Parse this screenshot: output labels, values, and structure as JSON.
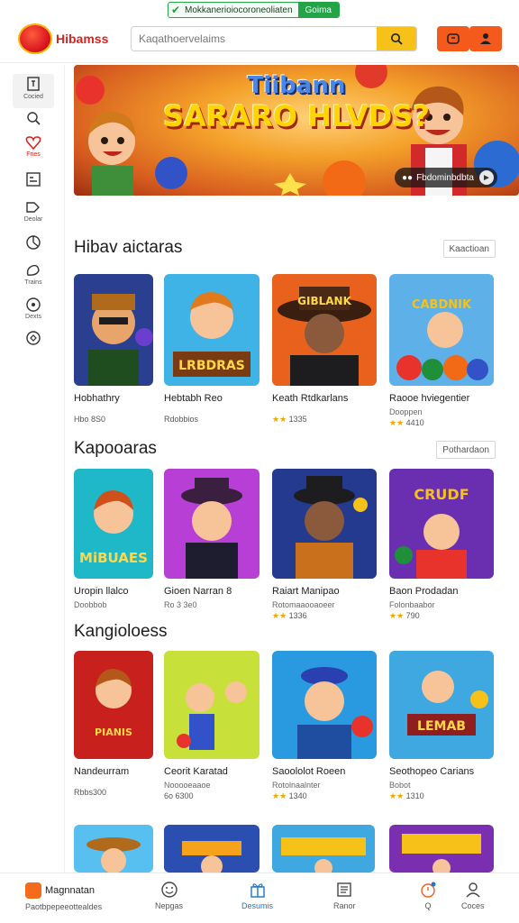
{
  "announcement": {
    "text": "Mokkanerioiocoroneoliaten",
    "button": "Goima"
  },
  "header": {
    "logo_badge": "ROOM LOGO",
    "logo_name": "Hibamss",
    "search_placeholder": "Kaqathoervelaims"
  },
  "sidebar": {
    "items": [
      {
        "label": "Cocied",
        "icon": "bookmark-icon"
      },
      {
        "label": "",
        "icon": "search-icon"
      },
      {
        "label": "Fries",
        "icon": "heart-icon"
      },
      {
        "label": "",
        "icon": "document-icon"
      },
      {
        "label": "Deolar",
        "icon": "tag-icon"
      },
      {
        "label": "",
        "icon": "chart-icon"
      },
      {
        "label": "Trains",
        "icon": "globe-icon"
      },
      {
        "label": "Dexts",
        "icon": "circle-icon"
      },
      {
        "label": "",
        "icon": "badge-icon"
      }
    ]
  },
  "banner": {
    "title1": "Tiibann",
    "title2": "SARARO HLVDS?",
    "cta": "Fbdominbdbta"
  },
  "sections": [
    {
      "title": "Hibav aictaras",
      "more": "Kaactioan",
      "cards": [
        {
          "name": "Hobhathry",
          "sub": "",
          "rate": "Hbo 8S0",
          "stars": ""
        },
        {
          "name": "Hebtabh Reo",
          "sub": "",
          "rate": "Rdobbios",
          "stars": ""
        },
        {
          "name": "Keath Rtdkarlans",
          "sub": "",
          "rate": "1335",
          "stars": "★★"
        },
        {
          "name": "Raooe hviegentier",
          "sub": "Dooppen",
          "rate": "4410",
          "stars": "★★"
        }
      ]
    },
    {
      "title": "Kapooaras",
      "more": "Pothardaon",
      "cards": [
        {
          "name": "Uropin llalco",
          "sub": "",
          "rate": "Doobbob",
          "stars": ""
        },
        {
          "name": "Gioen Narran 8",
          "sub": "",
          "rate": "Ro 3 3e0",
          "stars": ""
        },
        {
          "name": "Raiart Manipao",
          "sub": "Rotomaaooaoeer",
          "rate": "1336",
          "stars": "★★"
        },
        {
          "name": "Baon Prodadan",
          "sub": "Folonbaabor",
          "rate": "790",
          "stars": "★★"
        }
      ]
    },
    {
      "title": "Kangioloess",
      "more": "",
      "cards": [
        {
          "name": "Nandeurram",
          "sub": "",
          "rate": "Rbbs300",
          "stars": ""
        },
        {
          "name": "Ceorit Karatad",
          "sub": "Nooooeaaoe",
          "rate": "6o 6300",
          "stars": ""
        },
        {
          "name": "Saoololot Roeen",
          "sub": "Rotolnaalnter",
          "rate": "1340",
          "stars": "★★"
        },
        {
          "name": "Seothopeo Carians",
          "sub": "Bobot",
          "rate": "1310",
          "stars": "★★"
        }
      ]
    }
  ],
  "bottom_nav": {
    "brand": "Magnnatan",
    "brand_sub": "Paotbpepeeottealdes",
    "items": [
      {
        "label": "Nepgas",
        "icon": "smiley-icon"
      },
      {
        "label": "Desumis",
        "icon": "gift-icon"
      },
      {
        "label": "Ranor",
        "icon": "list-icon"
      },
      {
        "label": "Q",
        "icon": "timer-icon"
      },
      {
        "label": "Coces",
        "icon": "user-icon"
      }
    ]
  },
  "colors": {
    "accent": "#f35a1b",
    "brand_red": "#d8231e",
    "search_yellow": "#f6c21a",
    "green": "#22a447",
    "active_blue": "#1b76c9"
  }
}
